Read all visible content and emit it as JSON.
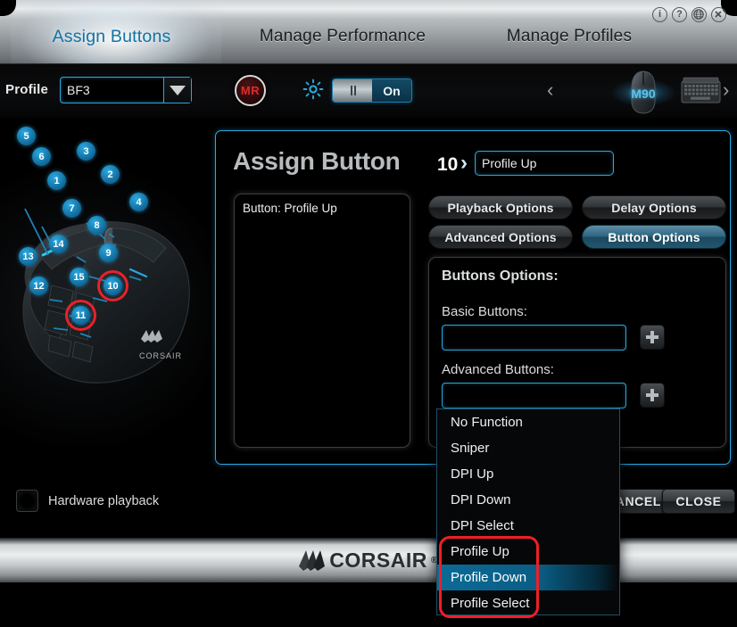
{
  "window": {
    "icons": [
      {
        "name": "info-icon",
        "glyph": "i"
      },
      {
        "name": "help-icon",
        "glyph": "?"
      },
      {
        "name": "language-globe-icon",
        "glyph": "globe"
      },
      {
        "name": "close-icon",
        "glyph": "x"
      }
    ]
  },
  "tabs": [
    {
      "label": "Assign Buttons",
      "active": true
    },
    {
      "label": "Manage Performance",
      "active": false
    },
    {
      "label": "Manage Profiles",
      "active": false
    }
  ],
  "profile_bar": {
    "label": "Profile",
    "selected_profile": "BF3",
    "macro_record_label": "MR",
    "brightness_icon": "sun-icon",
    "lighting_toggle": "On",
    "device_prev": "‹",
    "device_next": "›",
    "devices": [
      {
        "name": "M90",
        "label": "M90",
        "selected": true
      },
      {
        "name": "keyboard",
        "label": "",
        "selected": false
      }
    ]
  },
  "mouse_diagram": {
    "callouts": [
      "1",
      "2",
      "3",
      "4",
      "5",
      "6",
      "7",
      "8",
      "9",
      "10",
      "11",
      "12",
      "13",
      "14",
      "15"
    ],
    "highlighted": [
      "10",
      "11"
    ],
    "brand": "CORSAIR"
  },
  "hardware_playback": {
    "label": "Hardware playback",
    "checked": false
  },
  "main": {
    "title": "Assign Button",
    "button_number": "10",
    "chevron": "›",
    "assignment_name": "Profile Up",
    "macro_rows": [
      "Button: Profile Up"
    ],
    "option_buttons": [
      {
        "label": "Playback Options",
        "active": false
      },
      {
        "label": "Delay Options",
        "active": false
      },
      {
        "label": "Advanced Options",
        "active": false
      },
      {
        "label": "Button Options",
        "active": true
      }
    ],
    "buttons_options": {
      "title": "Buttons Options:",
      "basic_label": "Basic Buttons:",
      "basic_value": "",
      "advanced_label": "Advanced Buttons:",
      "advanced_value": "",
      "add_icon": "plus-icon"
    }
  },
  "dropdown": {
    "open": true,
    "selected": "Profile Down",
    "items": [
      {
        "label": "No Function",
        "selected": false
      },
      {
        "label": "Sniper",
        "selected": false
      },
      {
        "label": "DPI Up",
        "selected": false
      },
      {
        "label": "DPI Down",
        "selected": false
      },
      {
        "label": "DPI Select",
        "selected": false
      },
      {
        "label": "Profile Up",
        "selected": false
      },
      {
        "label": "Profile Down",
        "selected": true
      },
      {
        "label": "Profile Select",
        "selected": false
      }
    ],
    "annotation_color": "#ee1f27"
  },
  "actions": {
    "cancel": "CANCEL",
    "close": "CLOSE"
  },
  "footer": {
    "brand": "CORSAIR",
    "trademark": "®"
  },
  "colors": {
    "accent": "#2aa8e0",
    "active_tab_text": "#1273a6",
    "highlight": "#0b6b96",
    "annotation": "#ee1f27",
    "record_red": "#e02a2a"
  }
}
